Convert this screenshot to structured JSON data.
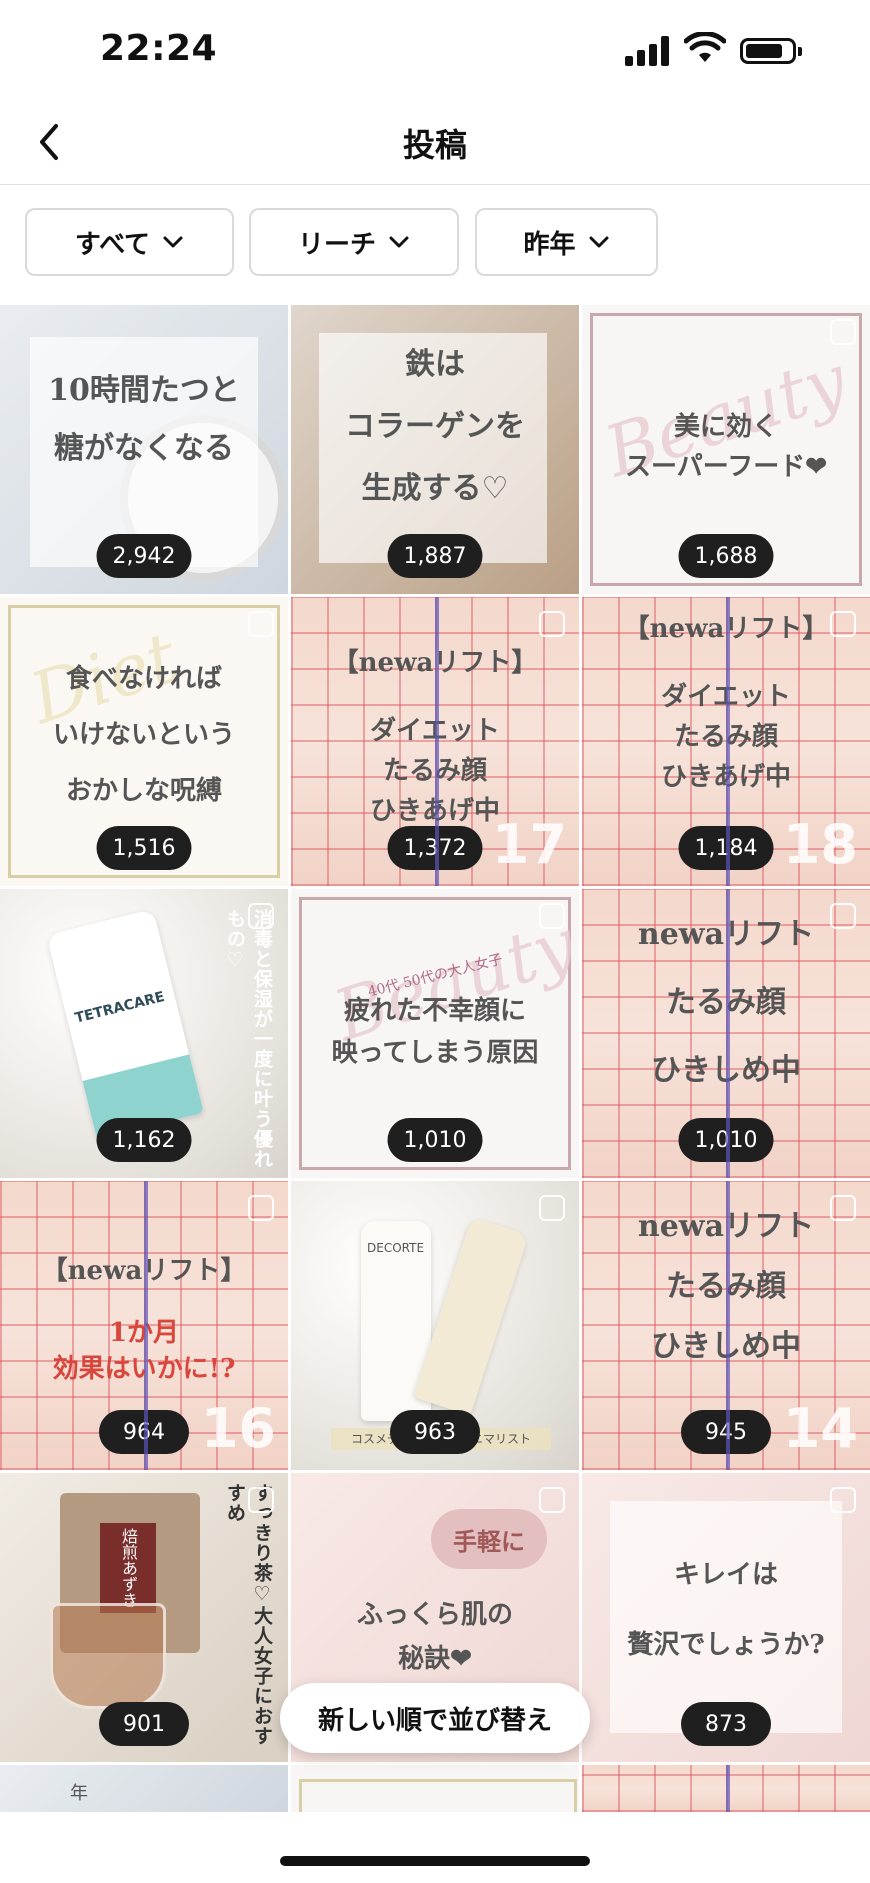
{
  "status_bar": {
    "time": "22:24"
  },
  "header": {
    "title": "投稿",
    "back_icon": "chevron-left-icon"
  },
  "filters": [
    {
      "label": "すべて"
    },
    {
      "label": "リーチ"
    },
    {
      "label": "昨年"
    }
  ],
  "posts": [
    {
      "lines": [
        "10時間たつと",
        "糖がなくなる"
      ],
      "count": "2,942"
    },
    {
      "lines": [
        "鉄は",
        "コラーゲンを",
        "生成する♡"
      ],
      "count": "1,887"
    },
    {
      "lines": [
        "美に効く",
        "スーパーフード❤"
      ],
      "deco": "Beauty",
      "count": "1,688"
    },
    {
      "lines": [
        "食べなければ",
        "いけないという",
        "おかしな呪縛"
      ],
      "deco": "Diet",
      "count": "1,516"
    },
    {
      "lines": [
        "【newaリフト】",
        "ダイエット",
        "たるみ顔",
        "ひきあげ中"
      ],
      "number": "17",
      "count": "1,372"
    },
    {
      "lines": [
        "【newaリフト】",
        "ダイエット",
        "たるみ顔",
        "ひきあげ中"
      ],
      "number": "18",
      "count": "1,184"
    },
    {
      "brand": "TETRACARE",
      "vertical": "消毒と保湿が一度に叶う優れもの♡",
      "count": "1,162"
    },
    {
      "sub": "40代 50代の大人女子",
      "lines": [
        "疲れた不幸顔に",
        "映ってしまう原因"
      ],
      "deco": "Beauty",
      "count": "1,010"
    },
    {
      "lines": [
        "newaリフト",
        "たるみ顔",
        "ひきしめ中"
      ],
      "count": "1,010"
    },
    {
      "lines": [
        "【newaリフト】"
      ],
      "red_lines": [
        "1か月",
        "効果はいかに!?"
      ],
      "number": "16",
      "count": "964"
    },
    {
      "brand": "DECORTE",
      "caption": "コスメデコルテ　　ミニマリスト",
      "count": "963"
    },
    {
      "lines": [
        "newaリフト",
        "たるみ顔",
        "ひきしめ中"
      ],
      "number": "14",
      "count": "945"
    },
    {
      "vertical": "すっきり茶♡大人女子におすすめ",
      "package": "焙煎あずき",
      "count": "901"
    },
    {
      "badge": "手軽に",
      "lines": [
        "ふっくら肌の",
        "秘訣❤"
      ],
      "count": ""
    },
    {
      "lines": [
        "キレイは",
        "贅沢でしょうか?"
      ],
      "count": "873"
    }
  ],
  "partial_row": {
    "text": "年"
  },
  "sort_button": {
    "label": "新しい順で並び替え"
  }
}
